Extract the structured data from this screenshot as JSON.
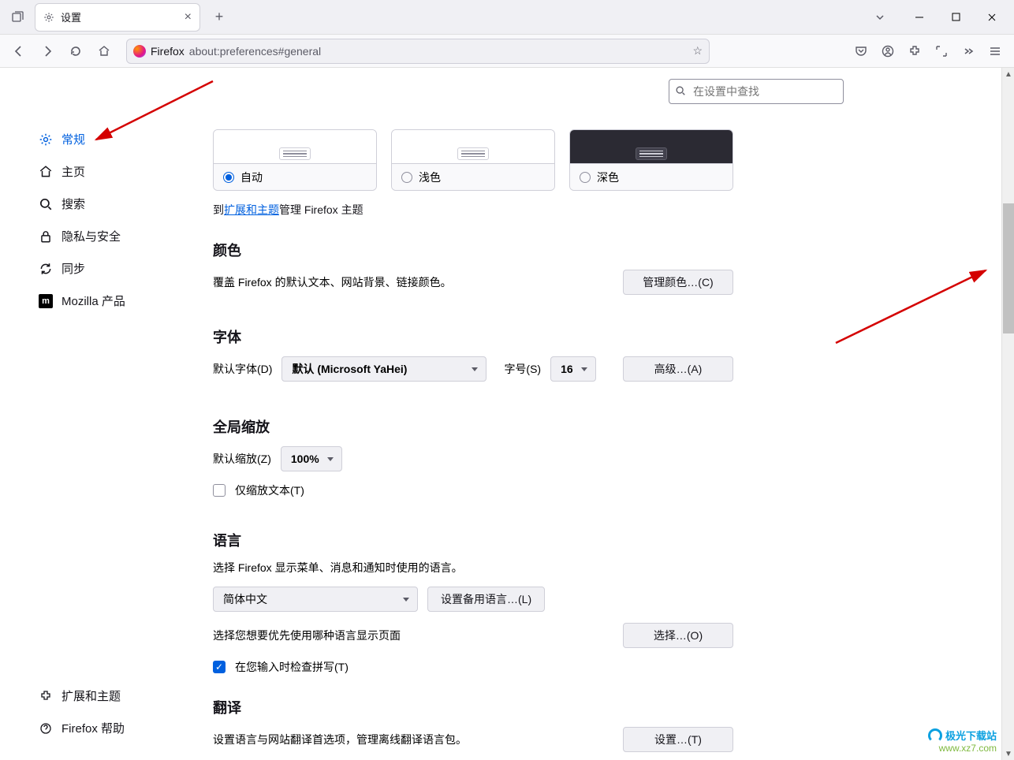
{
  "titlebar": {
    "tab_title": "设置"
  },
  "navbar": {
    "identity_label": "Firefox",
    "url": "about:preferences#general"
  },
  "search": {
    "placeholder": "在设置中查找"
  },
  "sidebar": {
    "items": [
      {
        "label": "常规",
        "active": true
      },
      {
        "label": "主页"
      },
      {
        "label": "搜索"
      },
      {
        "label": "隐私与安全"
      },
      {
        "label": "同步"
      },
      {
        "label": "Mozilla 产品"
      }
    ],
    "bottom": [
      {
        "label": "扩展和主题"
      },
      {
        "label": "Firefox 帮助"
      }
    ]
  },
  "themes": {
    "auto": "自动",
    "light": "浅色",
    "dark": "深色",
    "link_prefix": "到",
    "link_text": "扩展和主题",
    "link_suffix": "管理 Firefox 主题"
  },
  "colors": {
    "heading": "颜色",
    "desc": "覆盖 Firefox 的默认文本、网站背景、链接颜色。",
    "manage_btn": "管理颜色…(C)"
  },
  "fonts": {
    "heading": "字体",
    "default_label": "默认字体(D)",
    "default_value": "默认  (Microsoft YaHei)",
    "size_label": "字号(S)",
    "size_value": "16",
    "advanced_btn": "高级…(A)"
  },
  "zoom": {
    "heading": "全局缩放",
    "default_label": "默认缩放(Z)",
    "value": "100%",
    "text_only": "仅缩放文本(T)"
  },
  "language": {
    "heading": "语言",
    "desc1": "选择 Firefox 显示菜单、消息和通知时使用的语言。",
    "current": "简体中文",
    "alt_btn": "设置备用语言…(L)",
    "desc2": "选择您想要优先使用哪种语言显示页面",
    "choose_btn": "选择…(O)",
    "spellcheck": "在您输入时检查拼写(T)"
  },
  "translate": {
    "heading": "翻译",
    "desc": "设置语言与网站翻译首选项，管理离线翻译语言包。",
    "settings_btn": "设置…(T)"
  },
  "watermark": {
    "line1": "极光下载站",
    "line2": "www.xz7.com"
  }
}
